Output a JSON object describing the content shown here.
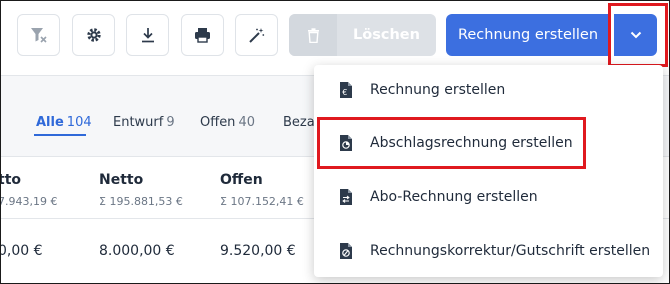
{
  "toolbar": {
    "icons": [
      "filter-clear-icon",
      "gear-icon",
      "download-icon",
      "printer-icon",
      "magic-wand-icon"
    ],
    "delete_label": "Löschen",
    "create_label": "Rechnung erstellen",
    "dropdown_icon": "chevron-down-icon",
    "accent_color": "#3c6fe0",
    "highlight_color": "#e0191f"
  },
  "tabs": [
    {
      "label": "Alle",
      "count": "104"
    },
    {
      "label": "Entwurf",
      "count": "9"
    },
    {
      "label": "Offen",
      "count": "40"
    },
    {
      "label": "Bezal",
      "count": ""
    }
  ],
  "table": {
    "columns": [
      {
        "label": "tto",
        "sum": "7.943,19 €"
      },
      {
        "label": "Netto",
        "sum": "Σ 195.881,53 €"
      },
      {
        "label": "Offen",
        "sum": "Σ 107.152,41 €"
      }
    ],
    "row": [
      "0,00 €",
      "8.000,00 €",
      "9.520,00 €"
    ]
  },
  "menu": {
    "items": [
      {
        "label": "Rechnung erstellen",
        "icon": "euro-document-icon"
      },
      {
        "label": "Abschlagsrechnung erstellen",
        "icon": "euro-partial-document-icon"
      },
      {
        "label": "Abo-Rechnung erstellen",
        "icon": "recurring-document-icon"
      },
      {
        "label": "Rechnungskorrektur/Gutschrift erstellen",
        "icon": "credit-note-document-icon"
      }
    ]
  }
}
